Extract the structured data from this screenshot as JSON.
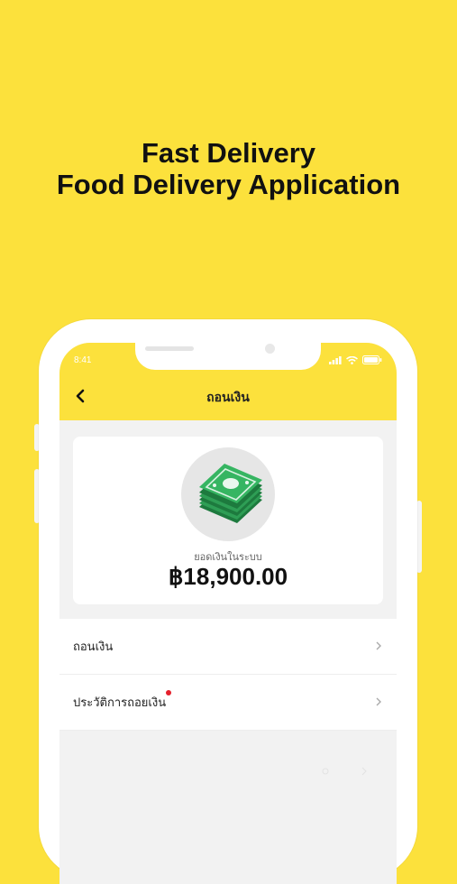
{
  "promo": {
    "line1": "Fast Delivery",
    "line2": "Food Delivery Application"
  },
  "status_bar": {
    "time": "8:41"
  },
  "nav": {
    "title": "ถอนเงิน"
  },
  "balance": {
    "label": "ยอดเงินในระบบ",
    "value": "฿18,900.00"
  },
  "menu": {
    "items": [
      {
        "label": "ถอนเงิน"
      },
      {
        "label": "ประวัติการถอยเงิน"
      }
    ]
  },
  "colors": {
    "background": "#FCE13C",
    "accent": "#FCE13C",
    "money_green": "#2E9E55",
    "notification_dot": "#E5202C"
  },
  "icons": [
    "back-arrow-icon",
    "money-stack-icon",
    "chevron-right-icon",
    "signal-icon",
    "wifi-icon",
    "battery-icon"
  ]
}
